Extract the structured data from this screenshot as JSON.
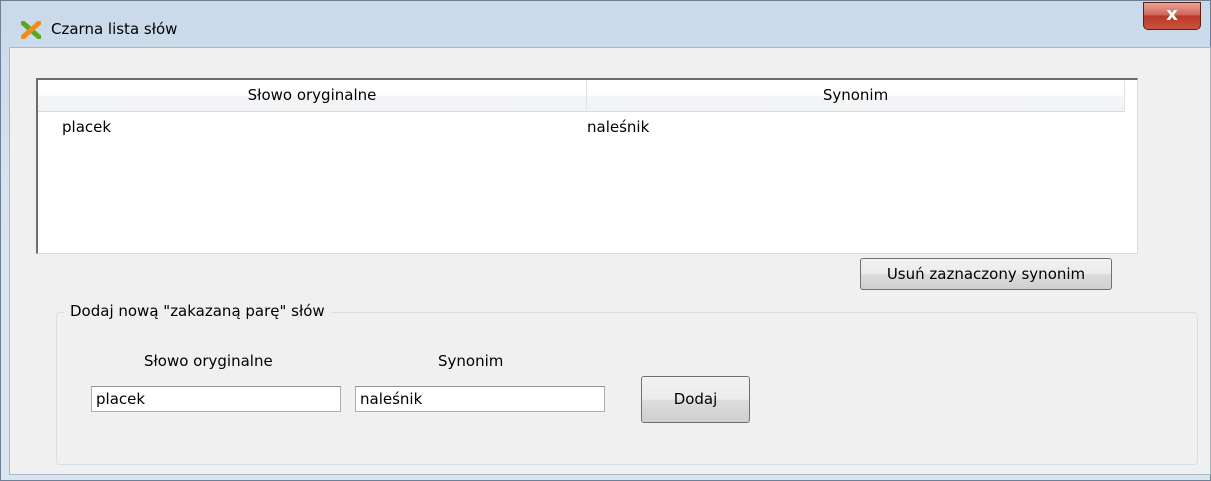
{
  "window": {
    "title": "Czarna lista słów",
    "close_glyph": "x"
  },
  "list": {
    "columns": [
      "Słowo oryginalne",
      "Synonim"
    ],
    "rows": [
      {
        "original": "placek",
        "synonym": "naleśnik"
      }
    ]
  },
  "remove_button_label": "Usuń zaznaczony synonim",
  "add_group": {
    "title": "Dodaj nową \"zakazaną parę\" słów",
    "original_label": "Słowo oryginalne",
    "synonym_label": "Synonim",
    "original_value": "placek",
    "synonym_value": "naleśnik",
    "add_button_label": "Dodaj"
  },
  "icons": {
    "app": "app-x-icon",
    "close": "close-icon"
  },
  "colors": {
    "close_button": "#c9543e",
    "frame": "#d7e3ef",
    "client": "#f0f0f0"
  }
}
